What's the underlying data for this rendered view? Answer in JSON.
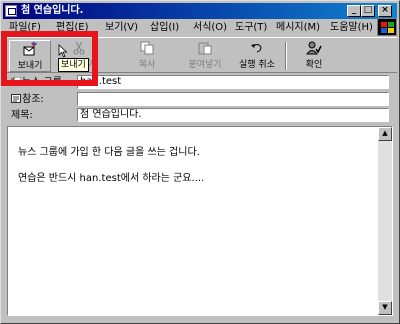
{
  "window": {
    "title": "첨 연습입니다."
  },
  "menu": [
    "파일(F)",
    "편집(E)",
    "보기(V)",
    "삽입(I)",
    "서식(O)",
    "도구(T)",
    "메시지(M)",
    "도움말(H)"
  ],
  "toolbar": {
    "send": "보내기",
    "cut": "잘라내기",
    "copy": "복사",
    "paste": "붙여넣기",
    "undo": "실행 취소",
    "check": "확인"
  },
  "tooltip": "보내기",
  "fields": {
    "newsgroups_label": "뉴스 그룹:",
    "newsgroups_value": "han.test",
    "cc_label": "참조:",
    "cc_value": "",
    "subject_label": "제목:",
    "subject_value": "첨 연습입니다."
  },
  "body": {
    "line1": "뉴스 그룹에 가입 한 다음 글을 쓰는 겁니다.",
    "line2": "연습은 반드시 han.test에서 하라는 군요...."
  },
  "colors": {
    "highlight_box": "#e8141c",
    "titlebar": "#000080"
  }
}
